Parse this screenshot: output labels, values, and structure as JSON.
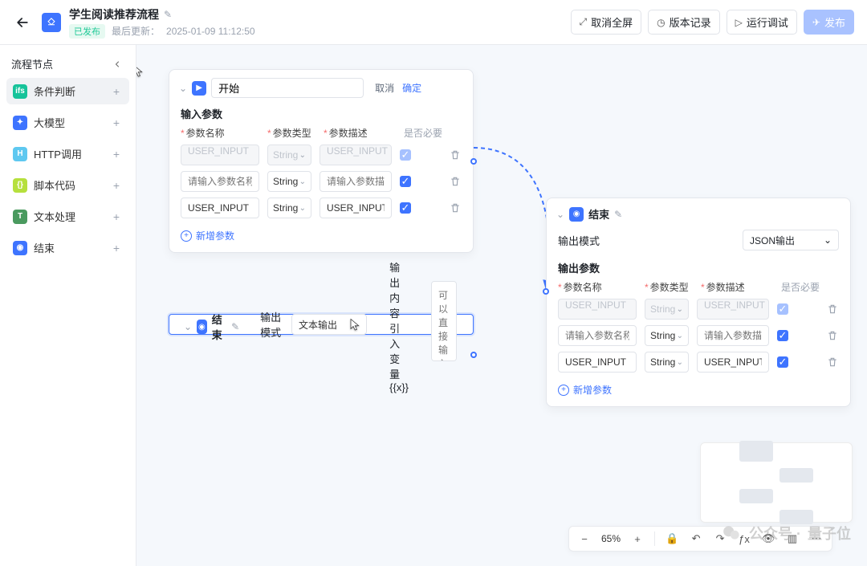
{
  "header": {
    "title": "学生阅读推荐流程",
    "status_badge": "已发布",
    "last_update_prefix": "最后更新：",
    "last_update_time": "2025-01-09 11:12:50",
    "buttons": {
      "exit_fullscreen": "取消全屏",
      "history": "版本记录",
      "run_debug": "运行调试",
      "publish": "发布"
    }
  },
  "sidebar": {
    "title": "流程节点",
    "items": [
      {
        "label": "条件判断",
        "color": "#16c39a",
        "icon": "ifs"
      },
      {
        "label": "大模型",
        "color": "#3e74ff",
        "icon": "✦"
      },
      {
        "label": "HTTP调用",
        "color": "#5ec8f0",
        "icon": "H"
      },
      {
        "label": "脚本代码",
        "color": "#b6e03d",
        "icon": "{}"
      },
      {
        "label": "文本处理",
        "color": "#4a9a5f",
        "icon": "T"
      },
      {
        "label": "结束",
        "color": "#3e74ff",
        "icon": "◉"
      }
    ]
  },
  "start_node": {
    "title_value": "开始",
    "title_cancel": "取消",
    "title_confirm": "确定",
    "section_input_params": "输入参数",
    "col_name": "参数名称",
    "col_type": "参数类型",
    "col_desc": "参数描述",
    "col_required": "是否必要",
    "rows": [
      {
        "name": "USER_INPUT",
        "type": "String",
        "desc": "USER_INPUT",
        "required": true,
        "ghost": true
      },
      {
        "name": "",
        "type": "String",
        "desc": "",
        "required": true,
        "ghost": false,
        "name_ph": "请输入参数名称",
        "desc_ph": "请输入参数描述"
      },
      {
        "name": "USER_INPUT",
        "type": "String",
        "desc": "USER_INPUT",
        "required": true,
        "ghost": false
      }
    ],
    "add_param": "新增参数"
  },
  "end_left": {
    "title": "结束",
    "output_mode_label": "输出模式",
    "output_mode_value": "文本输出",
    "output_content_label": "输出内容",
    "var_link": "引入变量{{x}}",
    "textarea_ph": "可以直接输入“/”插入变量"
  },
  "end_right": {
    "title": "结束",
    "output_mode_label": "输出模式",
    "output_mode_value": "JSON输出",
    "section_output_params": "输出参数",
    "col_name": "参数名称",
    "col_type": "参数类型",
    "col_desc": "参数描述",
    "col_required": "是否必要",
    "rows": [
      {
        "name": "USER_INPUT",
        "type": "String",
        "desc": "USER_INPUT",
        "required": true,
        "ghost": true
      },
      {
        "name": "",
        "type": "String",
        "desc": "",
        "required": true,
        "ghost": false,
        "name_ph": "请输入参数名称",
        "desc_ph": "请输入参数描述"
      },
      {
        "name": "USER_INPUT",
        "type": "String",
        "desc": "USER_INPUT",
        "required": true,
        "ghost": false
      }
    ],
    "add_param": "新增参数"
  },
  "controls": {
    "zoom": "65%"
  },
  "watermark": {
    "prefix": "公众号 ·",
    "name": "量子位"
  }
}
